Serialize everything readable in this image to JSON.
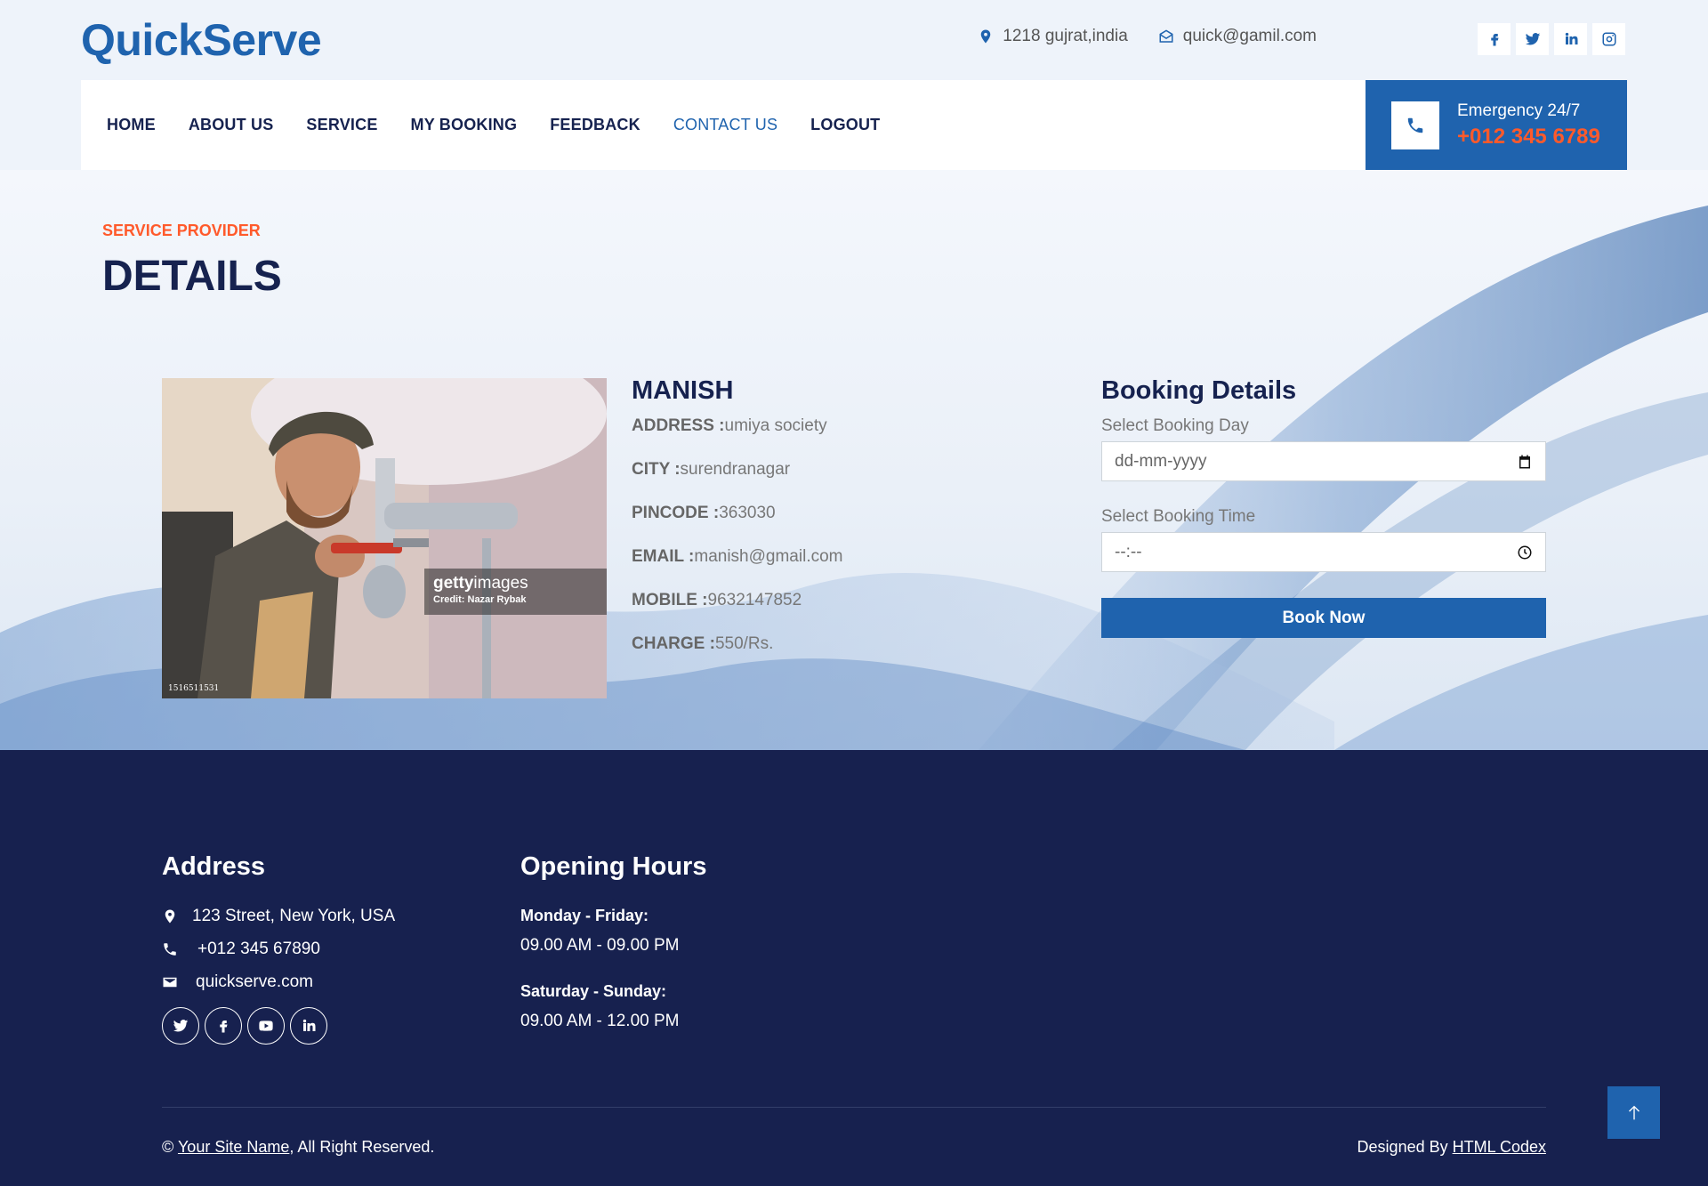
{
  "brand": "QuickServe",
  "top_contact": {
    "address": "1218 gujrat,india",
    "email": "quick@gamil.com"
  },
  "nav": {
    "items": [
      "HOME",
      "ABOUT US",
      "SERVICE",
      "MY BOOKING",
      "FEEDBACK",
      "CONTACT US",
      "LOGOUT"
    ],
    "active": "CONTACT US"
  },
  "emergency": {
    "label": "Emergency 24/7",
    "number": "+012 345 6789"
  },
  "page": {
    "kicker": "SERVICE PROVIDER",
    "title": "DETAILS"
  },
  "photo": {
    "watermark_brand": "getty",
    "watermark_suffix": "images",
    "credit": "Credit: Nazar Rybak",
    "id": "1516511531"
  },
  "provider": {
    "name": "MANISH",
    "fields": [
      {
        "label": "ADDRESS :",
        "value": "umiya society"
      },
      {
        "label": "CITY :",
        "value": "surendranagar"
      },
      {
        "label": "PINCODE :",
        "value": "363030"
      },
      {
        "label": "EMAIL :",
        "value": "manish@gmail.com"
      },
      {
        "label": "MOBILE :",
        "value": "9632147852"
      },
      {
        "label": "CHARGE :",
        "value": "550/Rs."
      }
    ]
  },
  "booking": {
    "title": "Booking Details",
    "day_label": "Select Booking Day",
    "day_placeholder": "dd-mm-yyyy",
    "time_label": "Select Booking Time",
    "time_placeholder": "--:--",
    "button": "Book Now"
  },
  "footer": {
    "address_title": "Address",
    "address": "123 Street, New York, USA",
    "phone": "+012 345 67890",
    "email": "quickserve.com",
    "hours_title": "Opening Hours",
    "weekday_label": "Monday - Friday:",
    "weekday_hours": "09.00 AM - 09.00 PM",
    "weekend_label": "Saturday - Sunday:",
    "weekend_hours": "09.00 AM - 12.00 PM",
    "copyright_prefix": "©",
    "site_name": "Your Site Name",
    "rights": ", All Right Reserved.",
    "designed_prefix": "Designed By",
    "designer": "HTML Codex"
  },
  "colors": {
    "primary": "#1f63ae",
    "accent": "#ff5a2b",
    "dark": "#16224f",
    "footer_bg": "#17214f"
  },
  "icons": [
    "map-pin-icon",
    "envelope-icon",
    "facebook-icon",
    "twitter-icon",
    "linkedin-icon",
    "instagram-icon",
    "phone-icon",
    "calendar-icon",
    "clock-icon",
    "youtube-icon",
    "arrow-up-icon"
  ]
}
